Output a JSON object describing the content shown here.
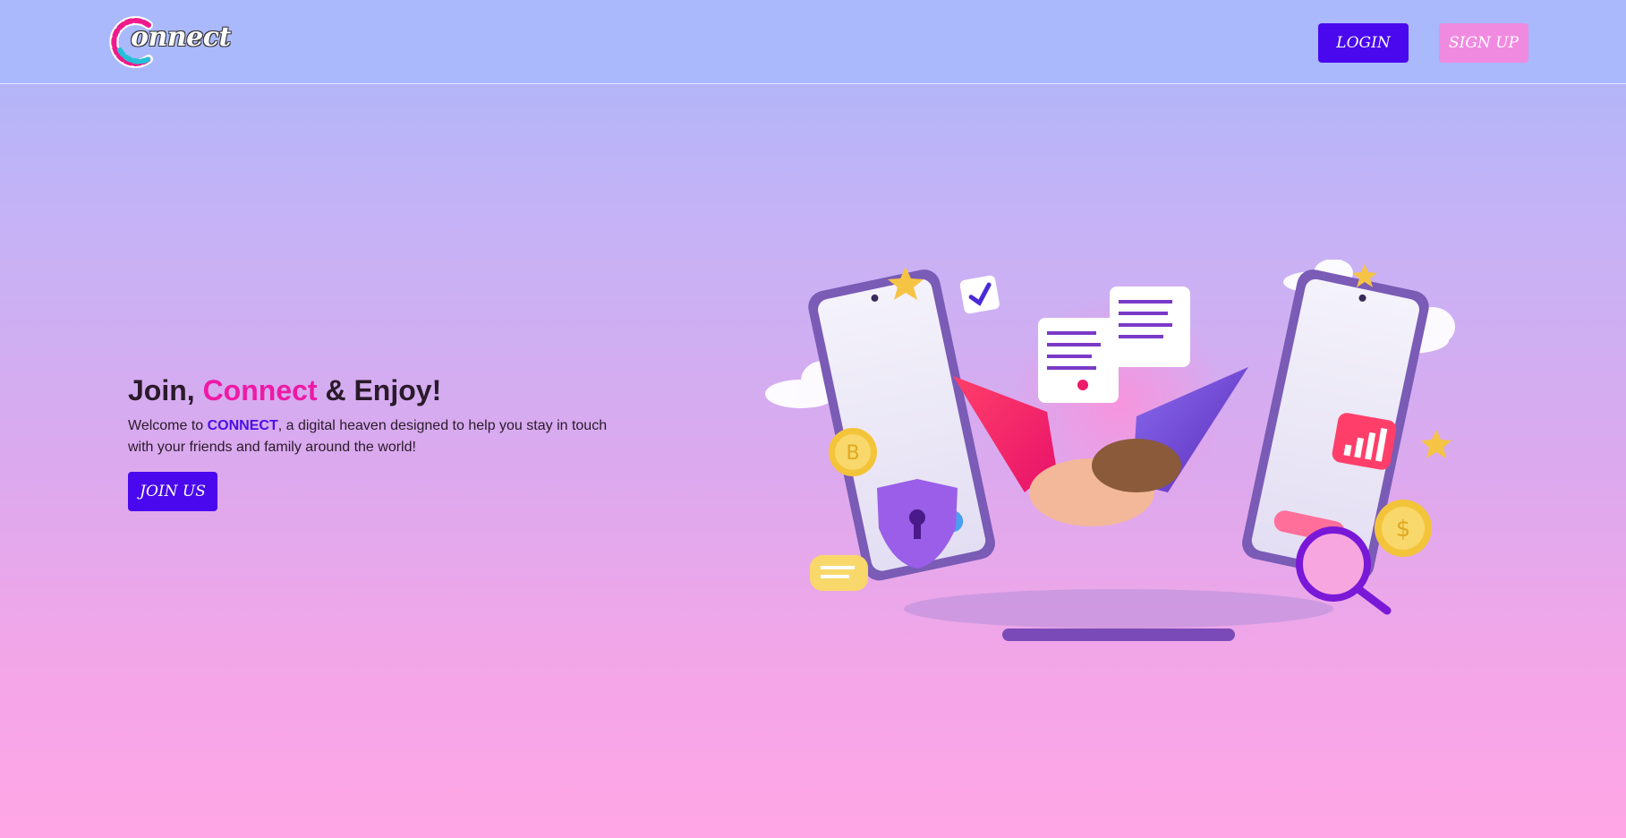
{
  "header": {
    "logo_text": "onnect",
    "login_label": "LOGIN",
    "signup_label": "SIGN UP"
  },
  "hero": {
    "title_part1": "Join, ",
    "title_accent": "Connect",
    "title_part2": " & Enjoy!",
    "desc_part1": "Welcome to ",
    "desc_brand": "CONNECT",
    "desc_part2": ", a digital heaven designed to help you stay in touch with your friends and family around the world!",
    "join_label": "JOIN US"
  },
  "colors": {
    "primary": "#4a08ee",
    "accent_pink": "#ee1aa6",
    "signup_pink": "#f08ae0",
    "header_bg": "#aab8fc"
  },
  "icons": [
    "connect-logo-icon",
    "handshake-illustration",
    "shield-lock-icon",
    "magnifier-icon",
    "coin-icon",
    "cloud-icon",
    "star-icon",
    "chat-bubble-icon",
    "checkmark-icon",
    "document-icon",
    "chart-badge-icon"
  ]
}
